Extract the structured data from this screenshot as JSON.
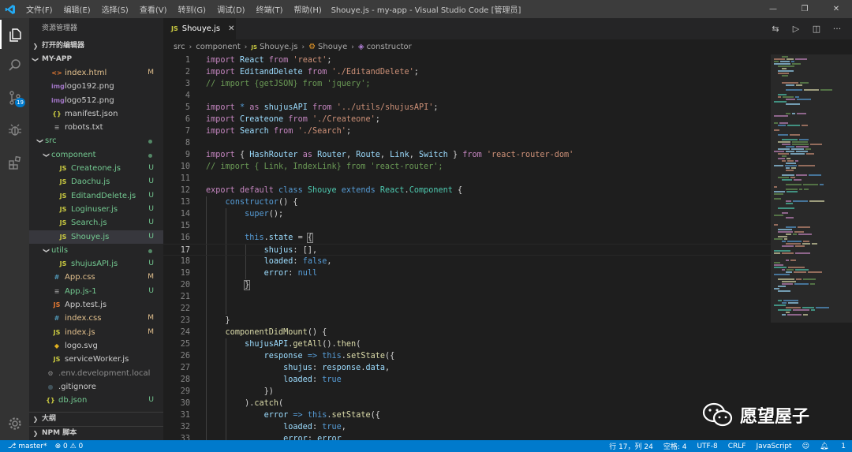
{
  "titlebar": {
    "menu": [
      "文件(F)",
      "编辑(E)",
      "选择(S)",
      "查看(V)",
      "转到(G)",
      "调试(D)",
      "终端(T)",
      "帮助(H)"
    ],
    "title": "Shouye.js - my-app - Visual Studio Code [管理员]"
  },
  "activity": {
    "scm_badge": "19"
  },
  "sidebar": {
    "header": "资源管理器",
    "open_editors": "打开的编辑器",
    "project": "MY-APP",
    "outline": "大纲",
    "npm": "NPM 脚本",
    "files": [
      {
        "name": "index.html",
        "icon": "<>",
        "icon_color": "#e37933",
        "status": "M",
        "kind": "mod",
        "indent": 0
      },
      {
        "name": "logo192.png",
        "icon": "img",
        "icon_color": "#a074c4",
        "status": "",
        "kind": "def",
        "indent": 0
      },
      {
        "name": "logo512.png",
        "icon": "img",
        "icon_color": "#a074c4",
        "status": "",
        "kind": "def",
        "indent": 0
      },
      {
        "name": "manifest.json",
        "icon": "{}",
        "icon_color": "#cbcb41",
        "status": "",
        "kind": "def",
        "indent": 0
      },
      {
        "name": "robots.txt",
        "icon": "≡",
        "icon_color": "#8c8c8c",
        "status": "",
        "kind": "def",
        "indent": 0
      },
      {
        "name": "src",
        "folder": true,
        "status": "dot",
        "kind": "new",
        "indent": -1
      },
      {
        "name": "component",
        "folder": true,
        "status": "dot",
        "kind": "new",
        "indent": 0
      },
      {
        "name": "Createone.js",
        "icon": "JS",
        "icon_color": "#cbcb41",
        "status": "U",
        "kind": "new",
        "indent": 1
      },
      {
        "name": "Daochu.js",
        "icon": "JS",
        "icon_color": "#cbcb41",
        "status": "U",
        "kind": "new",
        "indent": 1
      },
      {
        "name": "EditandDelete.js",
        "icon": "JS",
        "icon_color": "#cbcb41",
        "status": "U",
        "kind": "new",
        "indent": 1
      },
      {
        "name": "Loginuser.js",
        "icon": "JS",
        "icon_color": "#cbcb41",
        "status": "U",
        "kind": "new",
        "indent": 1
      },
      {
        "name": "Search.js",
        "icon": "JS",
        "icon_color": "#cbcb41",
        "status": "U",
        "kind": "new",
        "indent": 1
      },
      {
        "name": "Shouye.js",
        "icon": "JS",
        "icon_color": "#cbcb41",
        "status": "U",
        "kind": "new",
        "indent": 1,
        "selected": true
      },
      {
        "name": "utils",
        "folder": true,
        "status": "dot",
        "kind": "new",
        "indent": 0
      },
      {
        "name": "shujusAPI.js",
        "icon": "JS",
        "icon_color": "#cbcb41",
        "status": "U",
        "kind": "new",
        "indent": 1
      },
      {
        "name": "App.css",
        "icon": "#",
        "icon_color": "#519aba",
        "status": "M",
        "kind": "mod",
        "indent": 0
      },
      {
        "name": "App.js-1",
        "icon": "≡",
        "icon_color": "#8c8c8c",
        "status": "U",
        "kind": "new",
        "indent": 0
      },
      {
        "name": "App.test.js",
        "icon": "JS",
        "icon_color": "#e37933",
        "status": "",
        "kind": "def",
        "indent": 0
      },
      {
        "name": "index.css",
        "icon": "#",
        "icon_color": "#519aba",
        "status": "M",
        "kind": "mod",
        "indent": 0
      },
      {
        "name": "index.js",
        "icon": "JS",
        "icon_color": "#cbcb41",
        "status": "M",
        "kind": "mod",
        "indent": 0
      },
      {
        "name": "logo.svg",
        "icon": "◆",
        "icon_color": "#e0b020",
        "status": "",
        "kind": "def",
        "indent": 0
      },
      {
        "name": "serviceWorker.js",
        "icon": "JS",
        "icon_color": "#cbcb41",
        "status": "",
        "kind": "def",
        "indent": 0
      },
      {
        "name": ".env.development.local",
        "icon": "⚙",
        "icon_color": "#8c8c8c",
        "status": "",
        "kind": "ign",
        "indent": -1
      },
      {
        "name": ".gitignore",
        "icon": "●",
        "icon_color": "#41535b",
        "status": "",
        "kind": "def",
        "indent": -1
      },
      {
        "name": "db.json",
        "icon": "{}",
        "icon_color": "#cbcb41",
        "status": "U",
        "kind": "new",
        "indent": -1
      }
    ]
  },
  "editor": {
    "tab": {
      "icon": "JS",
      "label": "Shouye.js"
    },
    "breadcrumb": [
      "src",
      "component",
      "Shouye.js",
      "Shouye",
      "constructor"
    ],
    "cursor_line": 17,
    "lines": [
      {
        "n": "1",
        "html": "<span class='k'>import</span> <span class='v'>React</span> <span class='k'>from</span> <span class='s'>'react'</span>;"
      },
      {
        "n": "2",
        "html": "<span class='k'>import</span> <span class='v'>EditandDelete</span> <span class='k'>from</span> <span class='s'>'./EditandDelete'</span>;"
      },
      {
        "n": "3",
        "html": "<span class='c'>// import {getJSON} from 'jquery';</span>"
      },
      {
        "n": "4",
        "html": ""
      },
      {
        "n": "5",
        "html": "<span class='k'>import</span> <span class='kb'>*</span> <span class='k'>as</span> <span class='v'>shujusAPI</span> <span class='k'>from</span> <span class='s'>'../utils/shujusAPI'</span>;"
      },
      {
        "n": "6",
        "html": "<span class='k'>import</span> <span class='v'>Createone</span> <span class='k'>from</span> <span class='s'>'./Createone'</span>;"
      },
      {
        "n": "7",
        "html": "<span class='k'>import</span> <span class='v'>Search</span> <span class='k'>from</span> <span class='s'>'./Search'</span>;"
      },
      {
        "n": "8",
        "html": ""
      },
      {
        "n": "9",
        "html": "<span class='k'>import</span> { <span class='v'>HashRouter</span> <span class='k'>as</span> <span class='v'>Router</span>, <span class='v'>Route</span>, <span class='v'>Link</span>, <span class='v'>Switch</span> } <span class='k'>from</span> <span class='s'>'react-router-dom'</span>"
      },
      {
        "n": "10",
        "html": "<span class='c'>// import { Link, IndexLink} from 'react-router';</span>"
      },
      {
        "n": "11",
        "html": ""
      },
      {
        "n": "12",
        "html": "<span class='k'>export</span> <span class='k'>default</span> <span class='kb'>class</span> <span class='t'>Shouye</span> <span class='kb'>extends</span> <span class='t'>React</span>.<span class='t'>Component</span> {"
      },
      {
        "n": "13",
        "html": "    <span class='kb'>constructor</span>() {"
      },
      {
        "n": "14",
        "html": "        <span class='kb'>super</span>();"
      },
      {
        "n": "15",
        "html": ""
      },
      {
        "n": "16",
        "html": "        <span class='kb'>this</span>.<span class='v'>state</span> = <span class='p' style='outline:1px solid #888'>{</span>"
      },
      {
        "n": "17",
        "html": "            <span class='v'>shujus</span>: [],"
      },
      {
        "n": "18",
        "html": "            <span class='v'>loaded</span>: <span class='kb'>false</span>,"
      },
      {
        "n": "19",
        "html": "            <span class='v'>error</span>: <span class='kb'>null</span>"
      },
      {
        "n": "20",
        "html": "        <span class='p' style='outline:1px solid #888'>}</span>"
      },
      {
        "n": "21",
        "html": ""
      },
      {
        "n": "22",
        "html": ""
      },
      {
        "n": "23",
        "html": "    }"
      },
      {
        "n": "24",
        "html": "    <span class='f'>componentDidMount</span>() {"
      },
      {
        "n": "25",
        "html": "        <span class='v'>shujusAPI</span>.<span class='f'>getAll</span>().<span class='f'>then</span>("
      },
      {
        "n": "26",
        "html": "            <span class='v'>response</span> <span class='kb'>=&gt;</span> <span class='kb'>this</span>.<span class='f'>setState</span>({"
      },
      {
        "n": "27",
        "html": "                <span class='v'>shujus</span>: <span class='v'>response</span>.<span class='v'>data</span>,"
      },
      {
        "n": "28",
        "html": "                <span class='v'>loaded</span>: <span class='kb'>true</span>"
      },
      {
        "n": "29",
        "html": "            })"
      },
      {
        "n": "30",
        "html": "        ).<span class='f'>catch</span>("
      },
      {
        "n": "31",
        "html": "            <span class='v'>error</span> <span class='kb'>=&gt;</span> <span class='kb'>this</span>.<span class='f'>setState</span>({"
      },
      {
        "n": "32",
        "html": "                <span class='v'>loaded</span>: <span class='kb'>true</span>,"
      },
      {
        "n": "33",
        "html": "                <span class='v'>error</span>: <span class='v'>error</span>"
      }
    ]
  },
  "watermark": {
    "text": "愿望屋子"
  },
  "statusbar": {
    "branch": "master*",
    "problems": "⊗ 0 ⚠ 0",
    "position": "行 17，列 24",
    "spaces": "空格: 4",
    "encoding": "UTF-8",
    "eol": "CRLF",
    "language": "JavaScript",
    "notifications": "1"
  }
}
